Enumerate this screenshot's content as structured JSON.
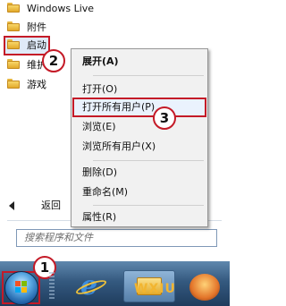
{
  "programs": {
    "items": [
      {
        "label": "Windows Live",
        "icon": "folder-icon"
      },
      {
        "label": "附件",
        "icon": "folder-icon"
      },
      {
        "label": "启动",
        "icon": "folder-icon"
      },
      {
        "label": "维护",
        "icon": "folder-icon"
      },
      {
        "label": "游戏",
        "icon": "folder-icon"
      }
    ],
    "back_label": "返回"
  },
  "search": {
    "placeholder": "搜索程序和文件"
  },
  "context_menu": {
    "items": [
      {
        "label": "展开(A)"
      },
      {
        "label": "打开(O)"
      },
      {
        "label": "打开所有用户(P)"
      },
      {
        "label": "浏览(E)"
      },
      {
        "label": "浏览所有用户(X)"
      },
      {
        "label": "删除(D)"
      },
      {
        "label": "重命名(M)"
      },
      {
        "label": "属性(R)"
      }
    ]
  },
  "callouts": {
    "one": "1",
    "two": "2",
    "three": "3"
  },
  "taskbar": {
    "icons": [
      "windows-start-orb-icon",
      "internet-explorer-icon",
      "windows-explorer-icon",
      "media-player-icon"
    ]
  },
  "watermark": {
    "text": "WXIU"
  },
  "colors": {
    "highlight_border": "#c41a27",
    "taskbar": "#34597f"
  }
}
